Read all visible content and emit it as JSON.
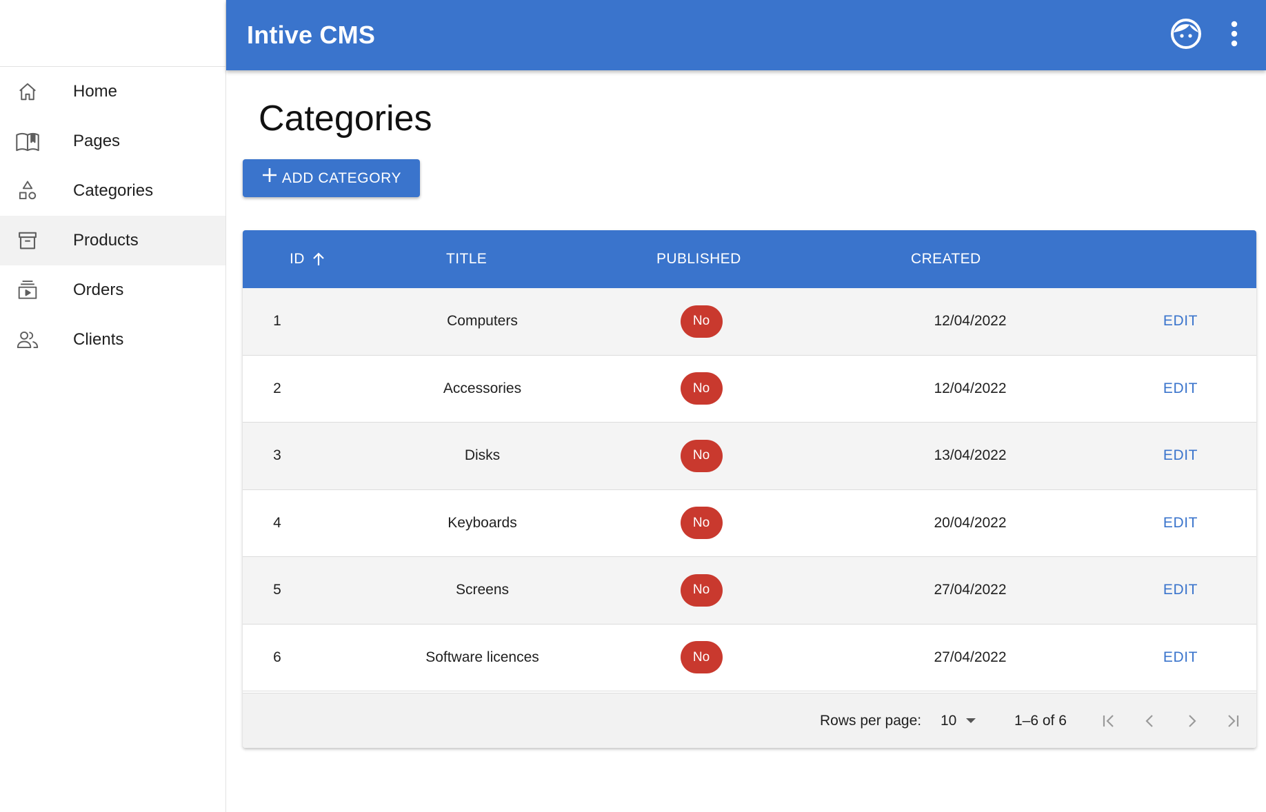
{
  "app": {
    "title": "Intive CMS"
  },
  "sidebar": {
    "items": [
      {
        "label": "Home",
        "icon": "home-icon",
        "active": false
      },
      {
        "label": "Pages",
        "icon": "book-icon",
        "active": false
      },
      {
        "label": "Categories",
        "icon": "shapes-icon",
        "active": false
      },
      {
        "label": "Products",
        "icon": "archive-icon",
        "active": true
      },
      {
        "label": "Orders",
        "icon": "queue-play-icon",
        "active": false
      },
      {
        "label": "Clients",
        "icon": "people-icon",
        "active": false
      }
    ]
  },
  "page": {
    "title": "Categories",
    "add_button_label": "ADD CATEGORY"
  },
  "table": {
    "columns": [
      "ID",
      "TITLE",
      "PUBLISHED",
      "CREATED"
    ],
    "sort_column": "ID",
    "sort_direction": "ascending",
    "rows": [
      {
        "id": "1",
        "title": "Computers",
        "published": "No",
        "created": "12/04/2022",
        "action": "EDIT"
      },
      {
        "id": "2",
        "title": "Accessories",
        "published": "No",
        "created": "12/04/2022",
        "action": "EDIT"
      },
      {
        "id": "3",
        "title": "Disks",
        "published": "No",
        "created": "13/04/2022",
        "action": "EDIT"
      },
      {
        "id": "4",
        "title": "Keyboards",
        "published": "No",
        "created": "20/04/2022",
        "action": "EDIT"
      },
      {
        "id": "5",
        "title": "Screens",
        "published": "No",
        "created": "27/04/2022",
        "action": "EDIT"
      },
      {
        "id": "6",
        "title": "Software licences",
        "published": "No",
        "created": "27/04/2022",
        "action": "EDIT"
      }
    ]
  },
  "pagination": {
    "rows_per_page_label": "Rows per page:",
    "rows_per_page_value": "10",
    "range_text": "1–6 of 6"
  },
  "colors": {
    "primary": "#3a74cc",
    "badge_no": "#c9392e",
    "row_alt": "#f4f4f4"
  }
}
